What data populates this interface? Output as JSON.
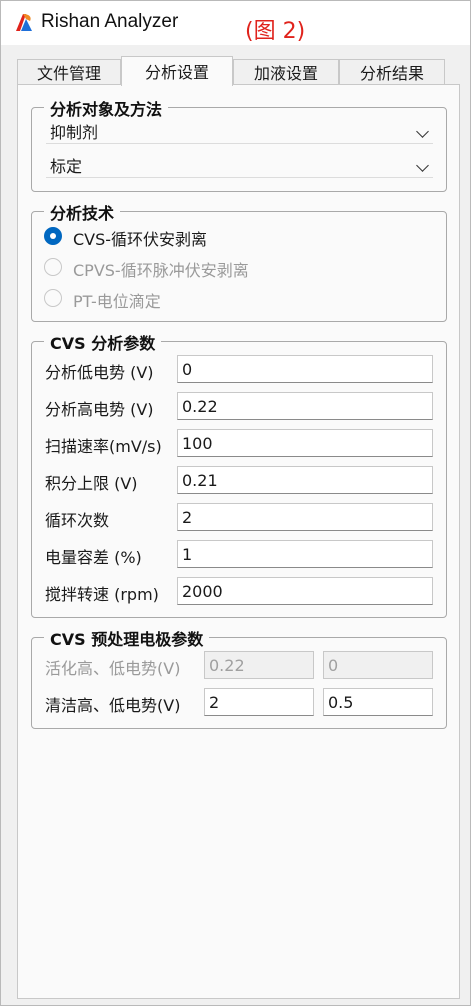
{
  "window": {
    "app_title": "Rishan Analyzer",
    "figure_tag": "(图 2)"
  },
  "tabs": [
    "文件管理",
    "分析设置",
    "加液设置",
    "分析结果"
  ],
  "active_tab": "分析设置",
  "analysis_object": {
    "title": "分析对象及方法",
    "target_value": "抑制剂",
    "method_value": "标定"
  },
  "technique": {
    "title": "分析技术",
    "options": [
      {
        "label": "CVS-循环伏安剥离",
        "selected": true,
        "enabled": true
      },
      {
        "label": "CPVS-循环脉冲伏安剥离",
        "selected": false,
        "enabled": false
      },
      {
        "label": "PT-电位滴定",
        "selected": false,
        "enabled": false
      }
    ]
  },
  "cvs_params": {
    "title": "CVS 分析参数",
    "rows": [
      {
        "label": "分析低电势 (V)",
        "value": "0"
      },
      {
        "label": "分析高电势 (V)",
        "value": "0.22"
      },
      {
        "label": "扫描速率(mV/s)",
        "value": "100"
      },
      {
        "label": "积分上限 (V)",
        "value": "0.21"
      },
      {
        "label": "循环次数",
        "value": "2"
      },
      {
        "label": "电量容差 (%)",
        "value": "1"
      },
      {
        "label": "搅拌转速 (rpm)",
        "value": "2000"
      }
    ]
  },
  "pretreat": {
    "title": "CVS 预处理电极参数",
    "activate_label": "活化高、低电势(V)",
    "activate_high": "0.22",
    "activate_low": "0",
    "clean_label": "清洁高、低电势(V)",
    "clean_high": "2",
    "clean_low": "0.5"
  },
  "colors": {
    "accent": "#0067c0",
    "figure_tag": "#e0231c"
  }
}
